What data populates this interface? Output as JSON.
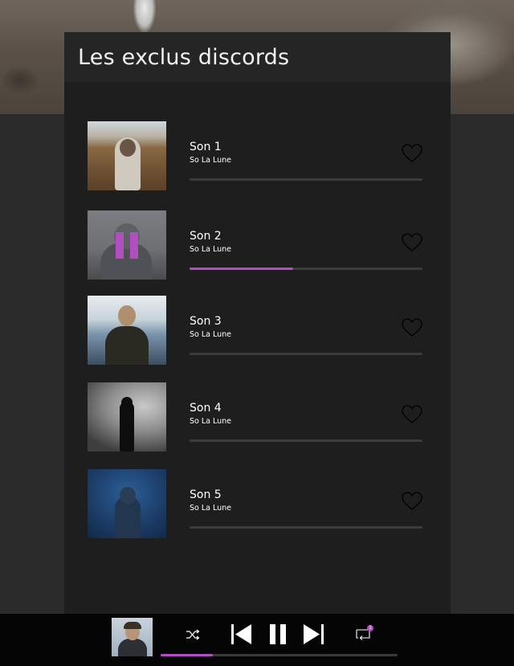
{
  "playlist": {
    "title": "Les exclus discords"
  },
  "tracks": [
    {
      "title": "Son 1",
      "artist": "So La Lune",
      "progress": 0.0,
      "playing": false,
      "liked": false
    },
    {
      "title": "Son 2",
      "artist": "So La Lune",
      "progress": 0.445,
      "playing": true,
      "liked": false
    },
    {
      "title": "Son 3",
      "artist": "So La Lune",
      "progress": 0.0,
      "playing": false,
      "liked": false
    },
    {
      "title": "Son 4",
      "artist": "So La Lune",
      "progress": 0.0,
      "playing": false,
      "liked": false
    },
    {
      "title": "Son 5",
      "artist": "So La Lune",
      "progress": 0.0,
      "playing": false,
      "liked": false
    }
  ],
  "player": {
    "progress": 0.22,
    "queue_count": "1",
    "icons": [
      "shuffle-icon",
      "previous-icon",
      "pause-icon",
      "next-icon",
      "queue-icon"
    ]
  },
  "colors": {
    "accent": "#b14fc1",
    "panel": "#1e1e1e",
    "header": "#252525",
    "player_bg": "#050505"
  }
}
